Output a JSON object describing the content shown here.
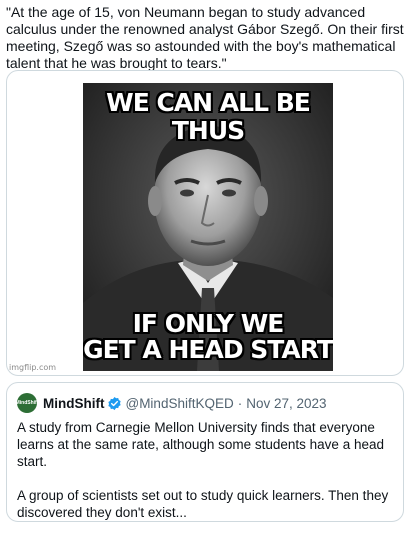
{
  "tweet": {
    "text": "\"At the age of 15, von Neumann began to study advanced calculus under the renowned analyst Gábor Szegő. On their first meeting, Szegő was so astounded with the boy's mathematical talent that he was brought to tears.\""
  },
  "meme": {
    "top_text": "WE CAN ALL BE THUS",
    "bottom_line1": "IF ONLY WE",
    "bottom_line2": "GET A HEAD START",
    "watermark": "imgflip.com"
  },
  "quoted_tweet": {
    "avatar_text": "MindShift",
    "name": "MindShift",
    "verified_icon": "verified-badge-icon",
    "handle": "@MindShiftKQED",
    "separator": "·",
    "date": "Nov 27, 2023",
    "paragraph1": "A study from Carnegie Mellon University finds that everyone learns at the same rate, although some students have a head start.",
    "paragraph2": "A group of scientists set out to study quick learners. Then they discovered they don't exist..."
  },
  "colors": {
    "verified": "#1d9bf0",
    "secondary_text": "#536471",
    "border": "#cfd9de",
    "avatar_bg": "#2d6e35"
  }
}
